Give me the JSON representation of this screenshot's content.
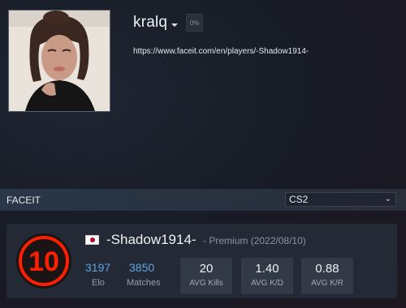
{
  "profile": {
    "username": "kralq",
    "completion_badge": "0%",
    "profile_url": "https://www.faceit.com/en/players/-Shadow1914-"
  },
  "faceit": {
    "section_title": "FACEIT",
    "game_selected": "CS2",
    "level": "10",
    "level_color": "#fe1f00",
    "country_flag": "japan-flag",
    "nickname": "-Shadow1914-",
    "membership": "- Premium (2022/08/10)",
    "elo": {
      "value": "3197",
      "label": "Elo"
    },
    "matches": {
      "value": "3850",
      "label": "Matches"
    },
    "stats": [
      {
        "value": "20",
        "label": "AVG Kills"
      },
      {
        "value": "1.40",
        "label": "AVG K/D"
      },
      {
        "value": "0.88",
        "label": "AVG K/R"
      }
    ]
  }
}
